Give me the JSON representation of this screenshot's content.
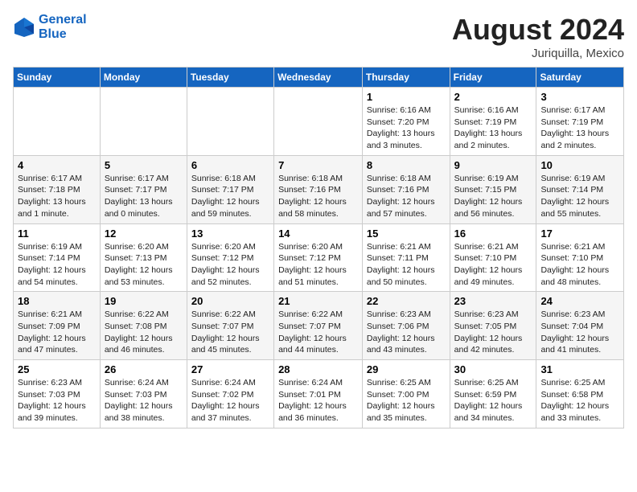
{
  "header": {
    "logo_line1": "General",
    "logo_line2": "Blue",
    "month_year": "August 2024",
    "location": "Juriquilla, Mexico"
  },
  "days_of_week": [
    "Sunday",
    "Monday",
    "Tuesday",
    "Wednesday",
    "Thursday",
    "Friday",
    "Saturday"
  ],
  "weeks": [
    [
      {
        "day": "",
        "info": ""
      },
      {
        "day": "",
        "info": ""
      },
      {
        "day": "",
        "info": ""
      },
      {
        "day": "",
        "info": ""
      },
      {
        "day": "1",
        "info": "Sunrise: 6:16 AM\nSunset: 7:20 PM\nDaylight: 13 hours\nand 3 minutes."
      },
      {
        "day": "2",
        "info": "Sunrise: 6:16 AM\nSunset: 7:19 PM\nDaylight: 13 hours\nand 2 minutes."
      },
      {
        "day": "3",
        "info": "Sunrise: 6:17 AM\nSunset: 7:19 PM\nDaylight: 13 hours\nand 2 minutes."
      }
    ],
    [
      {
        "day": "4",
        "info": "Sunrise: 6:17 AM\nSunset: 7:18 PM\nDaylight: 13 hours\nand 1 minute."
      },
      {
        "day": "5",
        "info": "Sunrise: 6:17 AM\nSunset: 7:17 PM\nDaylight: 13 hours\nand 0 minutes."
      },
      {
        "day": "6",
        "info": "Sunrise: 6:18 AM\nSunset: 7:17 PM\nDaylight: 12 hours\nand 59 minutes."
      },
      {
        "day": "7",
        "info": "Sunrise: 6:18 AM\nSunset: 7:16 PM\nDaylight: 12 hours\nand 58 minutes."
      },
      {
        "day": "8",
        "info": "Sunrise: 6:18 AM\nSunset: 7:16 PM\nDaylight: 12 hours\nand 57 minutes."
      },
      {
        "day": "9",
        "info": "Sunrise: 6:19 AM\nSunset: 7:15 PM\nDaylight: 12 hours\nand 56 minutes."
      },
      {
        "day": "10",
        "info": "Sunrise: 6:19 AM\nSunset: 7:14 PM\nDaylight: 12 hours\nand 55 minutes."
      }
    ],
    [
      {
        "day": "11",
        "info": "Sunrise: 6:19 AM\nSunset: 7:14 PM\nDaylight: 12 hours\nand 54 minutes."
      },
      {
        "day": "12",
        "info": "Sunrise: 6:20 AM\nSunset: 7:13 PM\nDaylight: 12 hours\nand 53 minutes."
      },
      {
        "day": "13",
        "info": "Sunrise: 6:20 AM\nSunset: 7:12 PM\nDaylight: 12 hours\nand 52 minutes."
      },
      {
        "day": "14",
        "info": "Sunrise: 6:20 AM\nSunset: 7:12 PM\nDaylight: 12 hours\nand 51 minutes."
      },
      {
        "day": "15",
        "info": "Sunrise: 6:21 AM\nSunset: 7:11 PM\nDaylight: 12 hours\nand 50 minutes."
      },
      {
        "day": "16",
        "info": "Sunrise: 6:21 AM\nSunset: 7:10 PM\nDaylight: 12 hours\nand 49 minutes."
      },
      {
        "day": "17",
        "info": "Sunrise: 6:21 AM\nSunset: 7:10 PM\nDaylight: 12 hours\nand 48 minutes."
      }
    ],
    [
      {
        "day": "18",
        "info": "Sunrise: 6:21 AM\nSunset: 7:09 PM\nDaylight: 12 hours\nand 47 minutes."
      },
      {
        "day": "19",
        "info": "Sunrise: 6:22 AM\nSunset: 7:08 PM\nDaylight: 12 hours\nand 46 minutes."
      },
      {
        "day": "20",
        "info": "Sunrise: 6:22 AM\nSunset: 7:07 PM\nDaylight: 12 hours\nand 45 minutes."
      },
      {
        "day": "21",
        "info": "Sunrise: 6:22 AM\nSunset: 7:07 PM\nDaylight: 12 hours\nand 44 minutes."
      },
      {
        "day": "22",
        "info": "Sunrise: 6:23 AM\nSunset: 7:06 PM\nDaylight: 12 hours\nand 43 minutes."
      },
      {
        "day": "23",
        "info": "Sunrise: 6:23 AM\nSunset: 7:05 PM\nDaylight: 12 hours\nand 42 minutes."
      },
      {
        "day": "24",
        "info": "Sunrise: 6:23 AM\nSunset: 7:04 PM\nDaylight: 12 hours\nand 41 minutes."
      }
    ],
    [
      {
        "day": "25",
        "info": "Sunrise: 6:23 AM\nSunset: 7:03 PM\nDaylight: 12 hours\nand 39 minutes."
      },
      {
        "day": "26",
        "info": "Sunrise: 6:24 AM\nSunset: 7:03 PM\nDaylight: 12 hours\nand 38 minutes."
      },
      {
        "day": "27",
        "info": "Sunrise: 6:24 AM\nSunset: 7:02 PM\nDaylight: 12 hours\nand 37 minutes."
      },
      {
        "day": "28",
        "info": "Sunrise: 6:24 AM\nSunset: 7:01 PM\nDaylight: 12 hours\nand 36 minutes."
      },
      {
        "day": "29",
        "info": "Sunrise: 6:25 AM\nSunset: 7:00 PM\nDaylight: 12 hours\nand 35 minutes."
      },
      {
        "day": "30",
        "info": "Sunrise: 6:25 AM\nSunset: 6:59 PM\nDaylight: 12 hours\nand 34 minutes."
      },
      {
        "day": "31",
        "info": "Sunrise: 6:25 AM\nSunset: 6:58 PM\nDaylight: 12 hours\nand 33 minutes."
      }
    ]
  ]
}
